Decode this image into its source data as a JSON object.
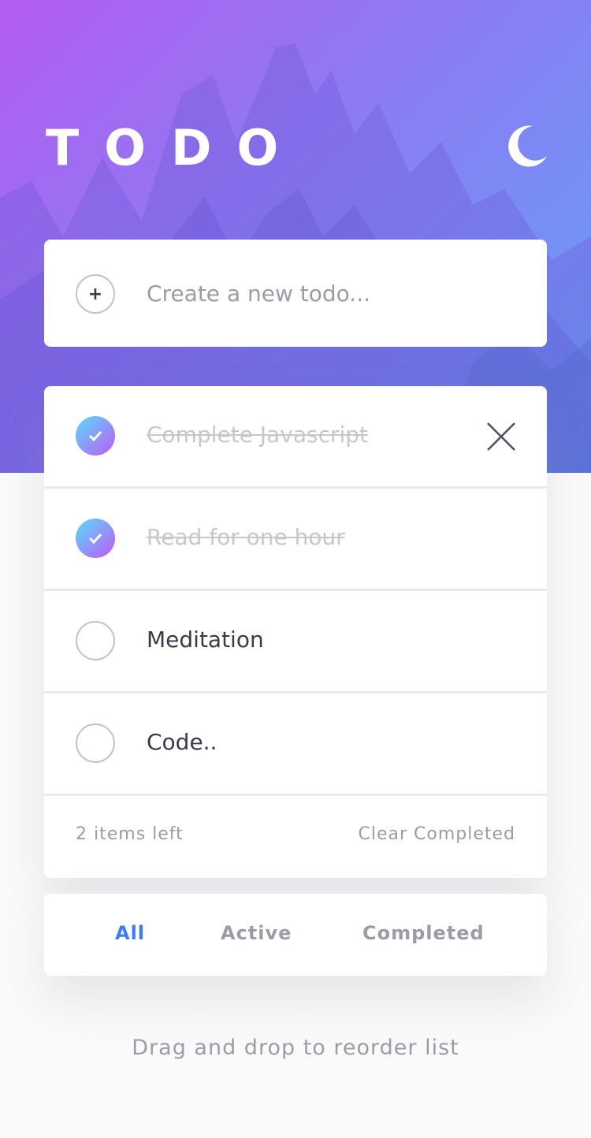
{
  "header": {
    "title": "TODO",
    "theme_icon": "moon-icon"
  },
  "new_todo": {
    "placeholder": "Create a new todo...",
    "value": "",
    "add_icon": "plus-icon"
  },
  "todos": [
    {
      "text": "Complete Javascript",
      "completed": true
    },
    {
      "text": "Read for one hour",
      "completed": true
    },
    {
      "text": "Meditation",
      "completed": false
    },
    {
      "text": "Code..",
      "completed": false
    }
  ],
  "footer": {
    "items_left": "2 items left",
    "clear_label": "Clear Completed"
  },
  "filters": {
    "all": "All",
    "active": "Active",
    "completed": "Completed",
    "selected": "All"
  },
  "hint": "Drag and drop to reorder list",
  "colors": {
    "accent": "#3a7cfd",
    "check_gradient_start": "#57ddff",
    "check_gradient_end": "#c058f3",
    "hero_start": "#b35cf0",
    "hero_end": "#62a1f7"
  }
}
